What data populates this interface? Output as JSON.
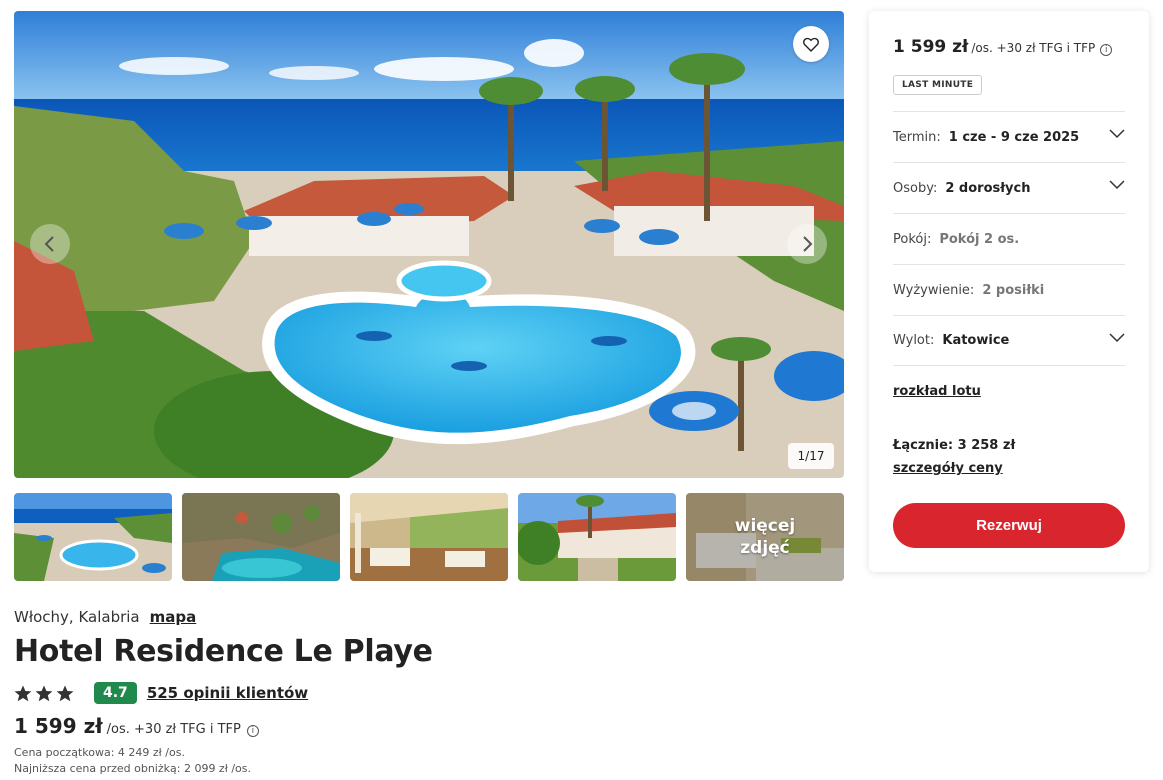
{
  "gallery": {
    "counter": "1/17",
    "more_photos_label": "więcej zdjęć",
    "favorite_icon": "heart-icon",
    "prev_icon": "chevron-left-icon",
    "next_icon": "chevron-right-icon"
  },
  "hotel": {
    "location": "Włochy, Kalabria",
    "map_link": "mapa",
    "name": "Hotel Residence Le Playe",
    "stars": 3,
    "score": "4.7",
    "reviews": "525 opinii klientów",
    "price": "1 599 zł",
    "price_suffix": "/os. +30 zł TFG i TFP",
    "initial_price": "Cena początkowa: 4 249 zł /os.",
    "lowest_price": "Najniższa cena przed obniżką: 2 099 zł /os."
  },
  "booking": {
    "price": "1 599 zł",
    "price_suffix": "/os. +30 zł TFG i TFP",
    "badge": "LAST MINUTE",
    "rows": [
      {
        "label": "Termin:",
        "value": "1 cze - 9 cze 2025",
        "dropdown": true
      },
      {
        "label": "Osoby:",
        "value": "2 dorosłych",
        "dropdown": true
      },
      {
        "label": "Pokój:",
        "value": "Pokój 2 os.",
        "dropdown": false
      },
      {
        "label": "Wyżywienie:",
        "value": "2 posiłki",
        "dropdown": false
      },
      {
        "label": "Wylot:",
        "value": "Katowice",
        "dropdown": true
      }
    ],
    "flight_link": "rozkład lotu",
    "total": "Łącznie: 3 258 zł",
    "details_link": "szczegóły ceny",
    "reserve_label": "Rezerwuj"
  },
  "colors": {
    "accent": "#d9252d",
    "score_bg": "#1f8a4c",
    "star": "#333333"
  }
}
